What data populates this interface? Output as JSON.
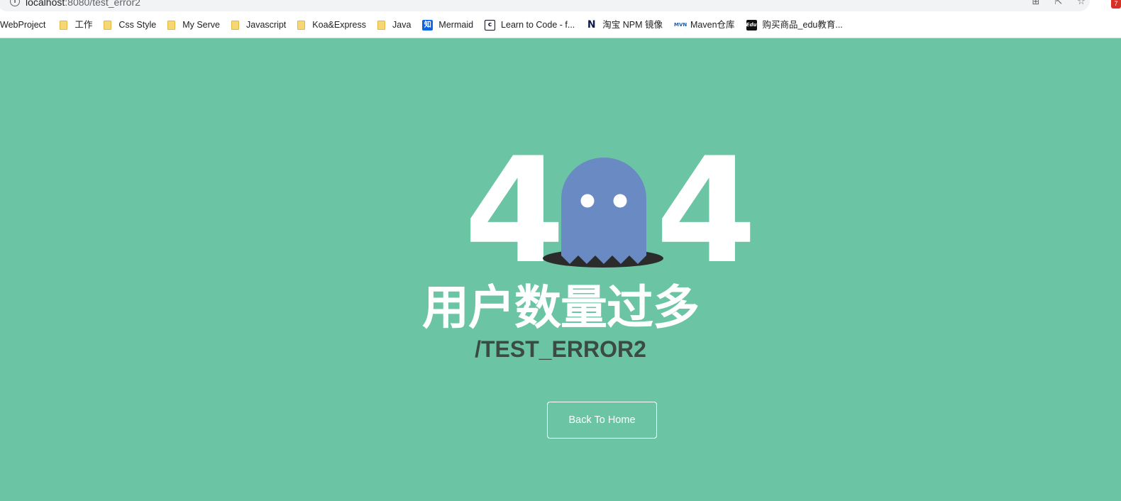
{
  "browser": {
    "url_host": "localhost",
    "url_rest": ":8080/test_error2",
    "extension_badge": "7",
    "bookmarks": [
      {
        "label": "WebProject",
        "icon": "none"
      },
      {
        "label": "工作",
        "icon": "folder-icon"
      },
      {
        "label": "Css Style",
        "icon": "folder-icon"
      },
      {
        "label": "My Serve",
        "icon": "folder-icon"
      },
      {
        "label": "Javascript",
        "icon": "folder-icon"
      },
      {
        "label": "Koa&Express",
        "icon": "folder-icon"
      },
      {
        "label": "Java",
        "icon": "folder-icon"
      },
      {
        "label": "Mermaid",
        "icon": "zhihu-icon",
        "icon_text": "知"
      },
      {
        "label": "Learn to Code - f...",
        "icon": "freecodecamp-icon",
        "icon_text": "c"
      },
      {
        "label": "淘宝 NPM 镜像",
        "icon": "npm-mirror-icon",
        "icon_text": "N"
      },
      {
        "label": "Maven仓库",
        "icon": "maven-icon",
        "icon_text": "MVN"
      },
      {
        "label": "购买商品_edu教育...",
        "icon": "edu-icon",
        "icon_text": "Edu"
      }
    ]
  },
  "error": {
    "digit_left": "4",
    "digit_right": "4",
    "message": "用户数量过多",
    "path": "/TEST_ERROR2",
    "button_label": "Back To Home"
  },
  "colors": {
    "background": "#6bc5a4",
    "ghost": "#6a8ac4",
    "hole": "#2b2b2b",
    "text": "#ffffff",
    "path_text": "#3b4a45"
  }
}
